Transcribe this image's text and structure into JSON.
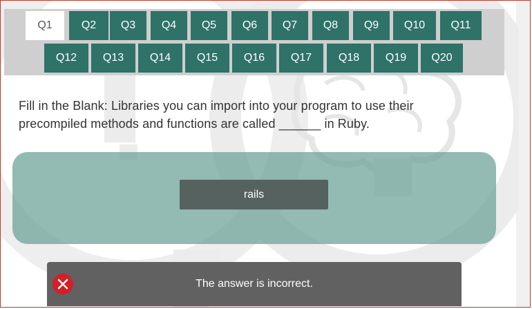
{
  "nav": {
    "active": "Q1",
    "row1": [
      "Q1",
      "Q2",
      "Q3",
      "Q4",
      "Q5",
      "Q6",
      "Q7",
      "Q8",
      "Q9",
      "Q10",
      "Q11"
    ],
    "row2": [
      "Q12",
      "Q13",
      "Q14",
      "Q15",
      "Q16",
      "Q17",
      "Q18",
      "Q19",
      "Q20"
    ]
  },
  "question": {
    "line1": "Fill in the Blank: Libraries you can import into your program to use their",
    "line2": "precompiled methods and functions are called ______ in Ruby."
  },
  "answer": {
    "label": "rails"
  },
  "feedback": {
    "text": "The answer is incorrect.",
    "icon": "close-icon"
  },
  "colors": {
    "nav_button": "#2e7268",
    "answer_panel": "#6aa096",
    "feedback_bg": "#616161",
    "error": "#d0202a"
  }
}
